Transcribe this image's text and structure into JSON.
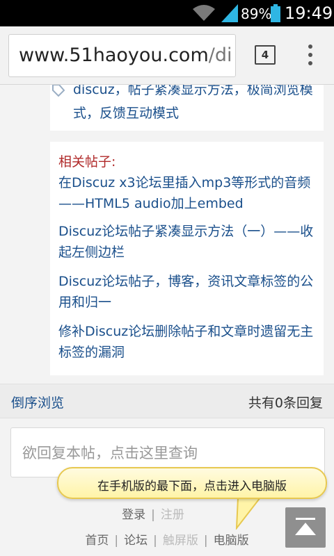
{
  "status_bar": {
    "battery_percent": "89%",
    "time": "19:49"
  },
  "browser": {
    "url_host": "www.51haoyou.com",
    "url_path": "/di",
    "tab_count": "4"
  },
  "tags": {
    "text": "discuz，帖子紧凑显示方法，极简浏览模式，反馈互动模式"
  },
  "related": {
    "title": "相关帖子:",
    "links": [
      {
        "label": "在Discuz x3论坛里插入mp3等形式的音频——HTML5 audio加上embed"
      },
      {
        "label": "Discuz论坛帖子紧凑显示方法（一）——收起左侧边栏"
      },
      {
        "label": "Discuz论坛帖子，博客，资讯文章标签的公用和归一"
      },
      {
        "label": "修补Discuz论坛删除帖子和文章时遗留无主标签的漏洞"
      }
    ]
  },
  "reply_bar": {
    "reverse_label": "倒序浏览",
    "count_label": "共有0条回复"
  },
  "reply_input": {
    "placeholder": "欲回复本帖，点击这里查询"
  },
  "footer": {
    "login": "登录",
    "sep1": "|",
    "register": "注册",
    "home": "首页",
    "sep2": "|",
    "forum": "论坛",
    "sep3": "|",
    "touch": "触屏版",
    "sep4": "|",
    "desktop": "电脑版"
  },
  "callout": {
    "text": "在手机版的最下面，点击进入电脑版"
  },
  "colors": {
    "link": "#1a4f8b",
    "related_title": "#b02a2a",
    "callout_bg": "#fff4a8"
  }
}
